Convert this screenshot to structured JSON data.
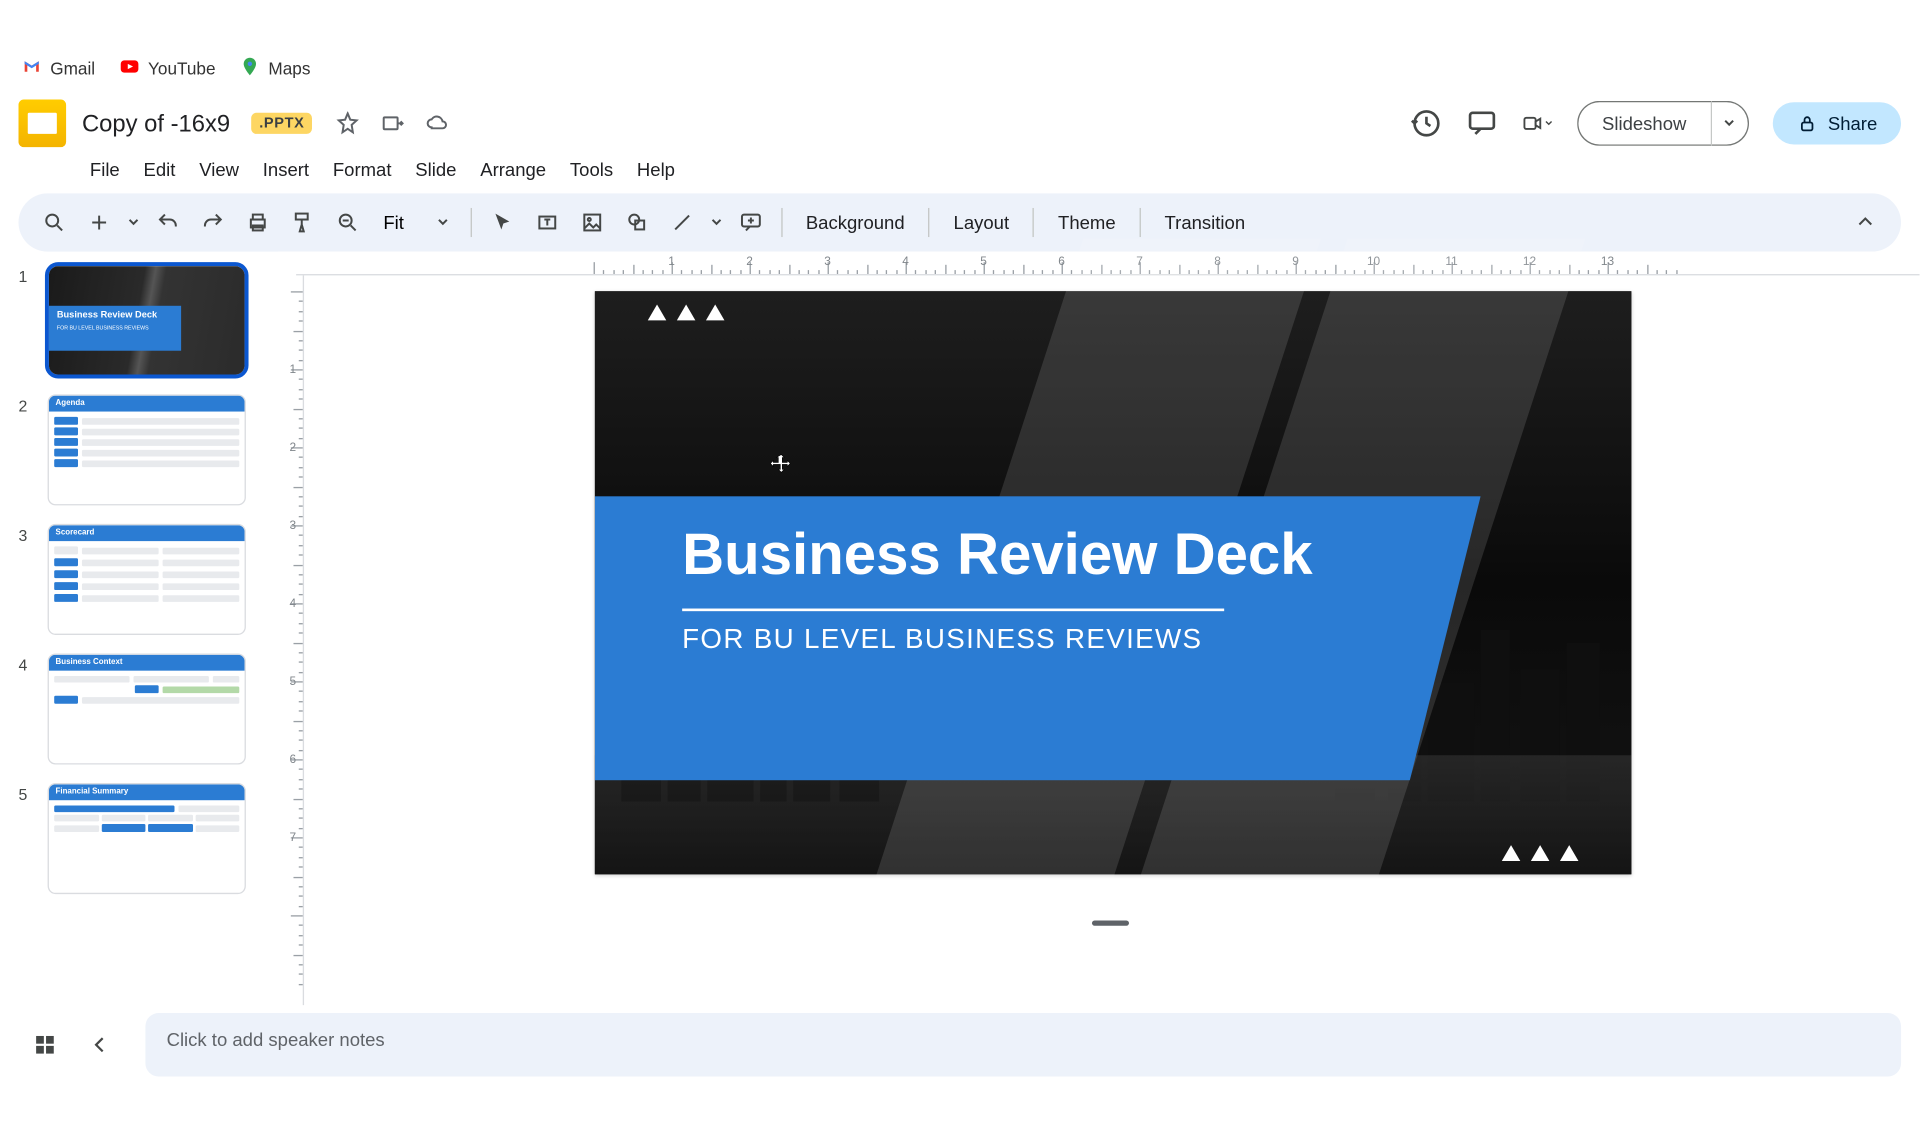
{
  "bookmarks": {
    "gmail": "Gmail",
    "youtube": "YouTube",
    "maps": "Maps"
  },
  "doc": {
    "title": "Copy of -16x9",
    "badge": ".PPTX"
  },
  "buttons": {
    "slideshow": "Slideshow",
    "share": "Share"
  },
  "menus": {
    "file": "File",
    "edit": "Edit",
    "view": "View",
    "insert": "Insert",
    "format": "Format",
    "slide": "Slide",
    "arrange": "Arrange",
    "tools": "Tools",
    "help": "Help"
  },
  "toolbar": {
    "zoom": "Fit",
    "background": "Background",
    "layout": "Layout",
    "theme": "Theme",
    "transition": "Transition"
  },
  "ruler_h": [
    1,
    2,
    3,
    4,
    5,
    6,
    7,
    8,
    9,
    10,
    11,
    12,
    13
  ],
  "ruler_v": [
    1,
    2,
    3,
    4,
    5,
    6,
    7
  ],
  "slide": {
    "title": "Business Review Deck",
    "subtitle": "FOR BU LEVEL BUSINESS REVIEWS"
  },
  "thumbnails": {
    "count": 5,
    "t1": {
      "title": "Business Review Deck",
      "sub": "FOR BU LEVEL BUSINESS REVIEWS"
    },
    "t2": {
      "title": "Agenda"
    },
    "t3": {
      "title": "Scorecard"
    },
    "t4": {
      "title": "Business Context"
    },
    "t5": {
      "title": "Financial Summary"
    }
  },
  "notes": {
    "placeholder": "Click to add speaker notes"
  }
}
